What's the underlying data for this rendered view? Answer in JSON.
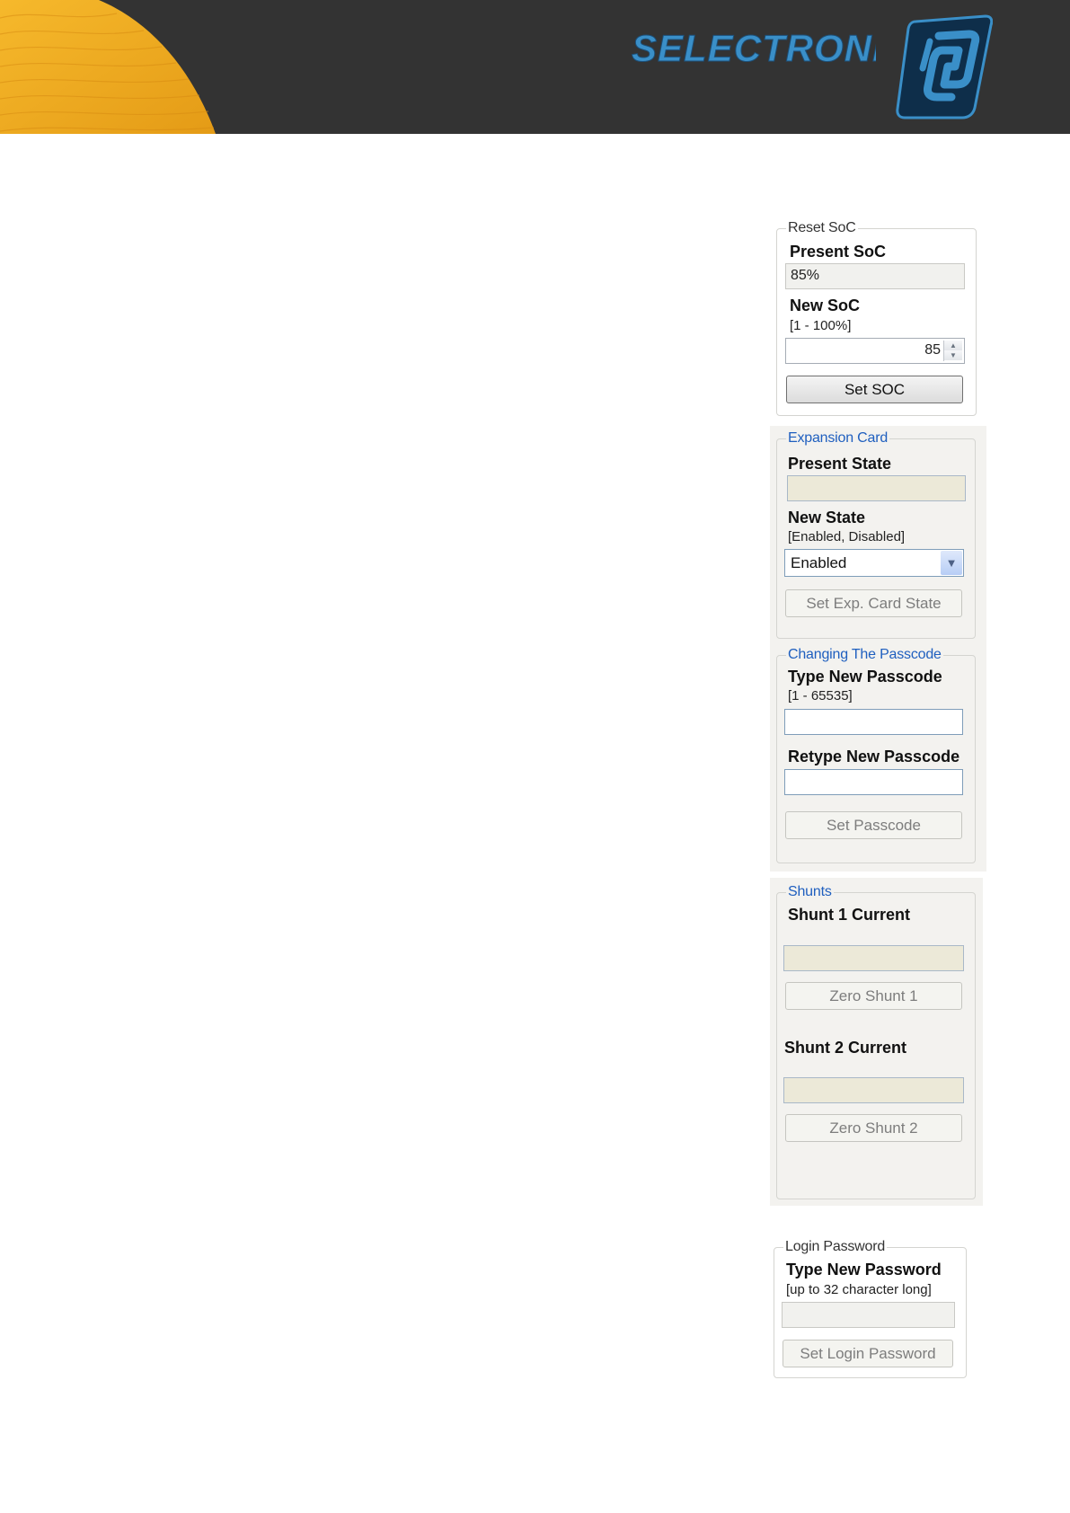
{
  "brand": {
    "name": "SELECTRONIC"
  },
  "reset_soc": {
    "legend": "Reset SoC",
    "present_label": "Present SoC",
    "present_value": "85%",
    "new_label": "New SoC",
    "new_hint": "[1 - 100%]",
    "new_value": "85",
    "button": "Set SOC"
  },
  "expansion_card": {
    "legend": "Expansion Card",
    "present_label": "Present State",
    "present_value": "",
    "new_label": "New State",
    "new_hint": "[Enabled, Disabled]",
    "selected": "Enabled",
    "button": "Set Exp. Card State"
  },
  "passcode": {
    "legend": "Changing The Passcode",
    "type_label": "Type New Passcode",
    "type_hint": "[1 - 65535]",
    "retype_label": "Retype New Passcode",
    "button": "Set Passcode"
  },
  "shunts": {
    "legend": "Shunts",
    "shunt1_label": "Shunt 1 Current",
    "shunt1_value": "",
    "shunt1_button": "Zero Shunt 1",
    "shunt2_label": "Shunt 2 Current",
    "shunt2_value": "",
    "shunt2_button": "Zero Shunt 2"
  },
  "login_password": {
    "legend": "Login Password",
    "type_label": "Type New Password",
    "type_hint": "[up to 32 character long]",
    "button": "Set Login Password"
  },
  "colors": {
    "banner": "#333333",
    "accent_orange": "#f0a820",
    "brand_blue": "#3a8fc8",
    "legend_blue": "#1f5fbf"
  }
}
